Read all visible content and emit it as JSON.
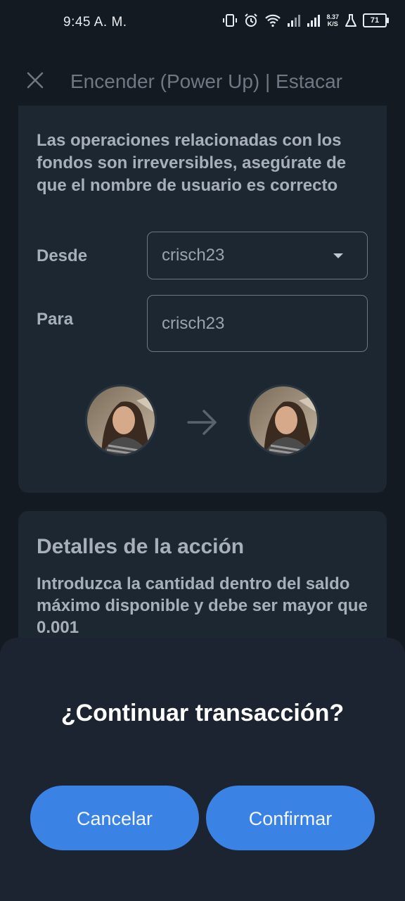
{
  "status_bar": {
    "time": "9:45 A. M.",
    "net_speed_value": "8.37",
    "net_speed_unit": "K/S",
    "battery": "71"
  },
  "header": {
    "title": "Encender (Power Up) | Estacar"
  },
  "transfer_card": {
    "warning": "Las operaciones relacionadas con los fondos son irreversibles, asegúrate de que el nombre de usuario es correcto",
    "from_label": "Desde",
    "from_value": "crisch23",
    "to_label": "Para",
    "to_value": "crisch23"
  },
  "details_card": {
    "title": "Detalles de la acción",
    "text": "Introduzca la cantidad dentro del saldo máximo disponible  y debe ser mayor que 0.001"
  },
  "dialog": {
    "title": "¿Continuar transacción?",
    "cancel_label": "Cancelar",
    "confirm_label": "Confirmar"
  },
  "colors": {
    "background": "#141a21",
    "card": "#1c2731",
    "sheet": "#1b2430",
    "accent": "#3a82e4"
  }
}
